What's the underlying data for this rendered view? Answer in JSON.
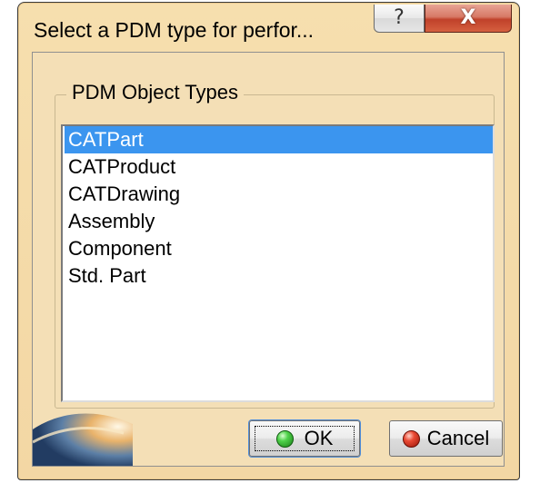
{
  "window": {
    "title": "Select a PDM type for perfor..."
  },
  "title_buttons": {
    "help_glyph": "?",
    "close_glyph": "X"
  },
  "group": {
    "legend": "PDM Object Types"
  },
  "list": {
    "items": [
      {
        "label": "CATPart",
        "selected": true
      },
      {
        "label": "CATProduct",
        "selected": false
      },
      {
        "label": "CATDrawing",
        "selected": false
      },
      {
        "label": "Assembly",
        "selected": false
      },
      {
        "label": "Component",
        "selected": false
      },
      {
        "label": "Std. Part",
        "selected": false
      }
    ]
  },
  "buttons": {
    "ok_label": "OK",
    "ok_icon": "green-light-icon",
    "cancel_label": "Cancel",
    "cancel_icon": "red-light-icon"
  },
  "colors": {
    "dialog_background": "#f4dfb6",
    "selection_highlight": "#3b95ef",
    "close_button": "#c0412a"
  }
}
